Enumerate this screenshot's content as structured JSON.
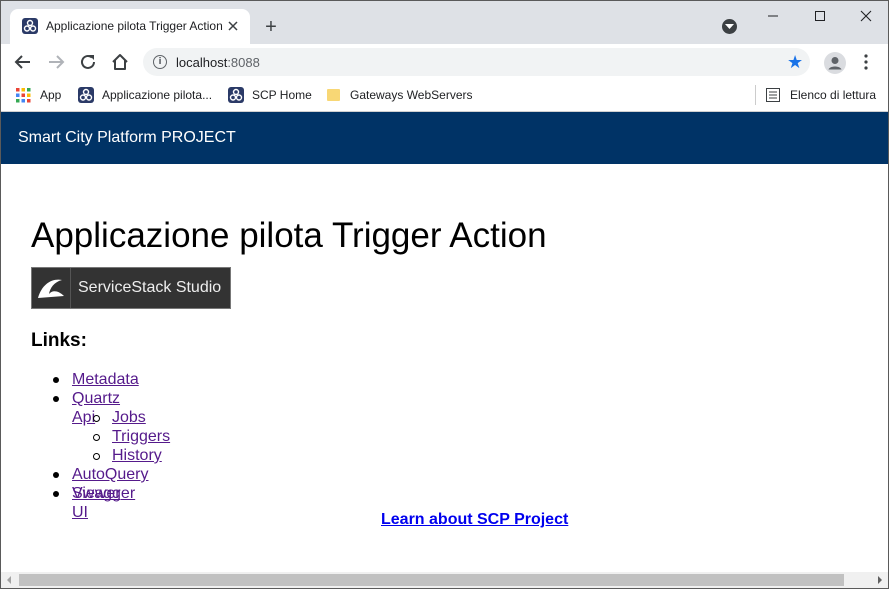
{
  "browser": {
    "tab_title": "Applicazione pilota Trigger Action",
    "new_tab_symbol": "+",
    "url_host": "localhost",
    "url_port": ":8088"
  },
  "bookmarks": {
    "items": [
      {
        "label": "App",
        "icon": "apps-grid-icon"
      },
      {
        "label": "Applicazione pilota...",
        "icon": "site-favicon-icon"
      },
      {
        "label": "SCP Home",
        "icon": "site-favicon-icon"
      },
      {
        "label": "Gateways WebServers",
        "icon": "folder-icon"
      }
    ],
    "reading_list": "Elenco di lettura"
  },
  "page": {
    "navbar_brand": "Smart City Platform PROJECT",
    "navbar_color": "#003366",
    "title": "Applicazione pilota Trigger Action",
    "studio_button": "ServiceStack Studio",
    "links_heading": "Links:",
    "links": [
      {
        "label": "Metadata",
        "level": 1
      },
      {
        "label": "Quartz Api",
        "level": 1
      },
      {
        "label": "Jobs",
        "level": 2
      },
      {
        "label": "Triggers",
        "level": 2
      },
      {
        "label": "History",
        "level": 2
      },
      {
        "label": "AutoQuery Viewer",
        "level": 1
      },
      {
        "label": "Swagger UI",
        "level": 1
      }
    ],
    "learn_link": "Learn about SCP Project"
  },
  "colors": {
    "link_visited": "#551a8b",
    "link": "#0000ee",
    "star": "#1a73e8"
  }
}
